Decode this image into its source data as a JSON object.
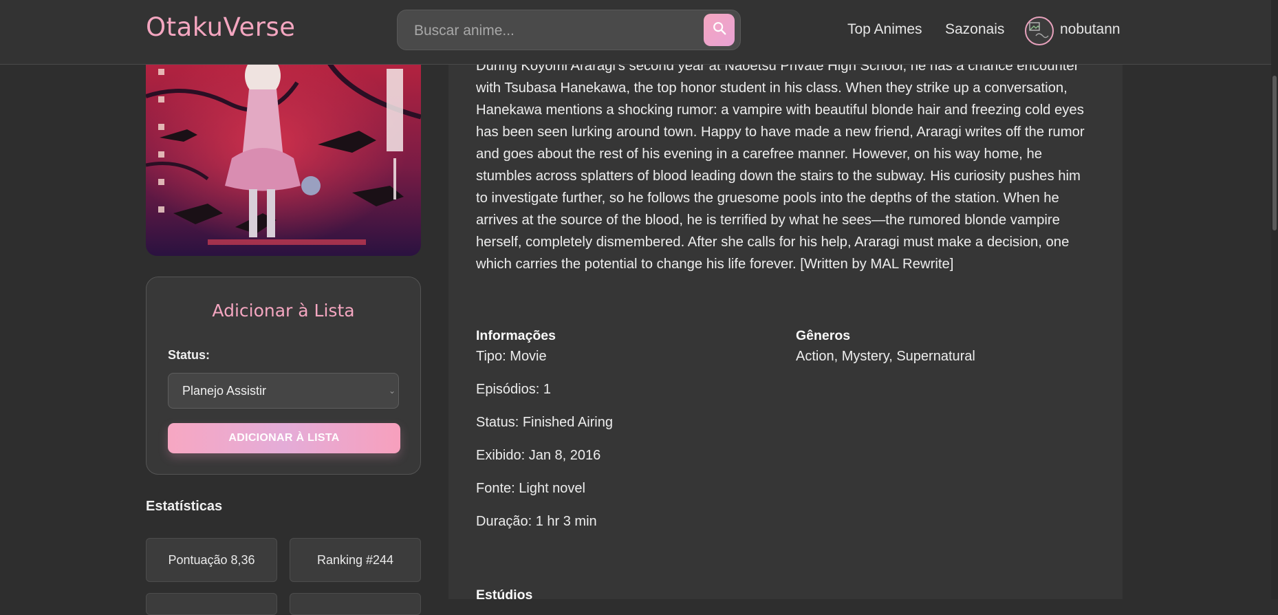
{
  "header": {
    "logo": "OtakuVerse",
    "search": {
      "placeholder": "Buscar anime...",
      "value": ""
    },
    "nav": [
      "Top Animes",
      "Sazonais"
    ],
    "username": "nobutann"
  },
  "poster": {
    "icon": "anime-poster-image",
    "colors": {
      "primary": "#c42a48",
      "secondary": "#2a1240"
    }
  },
  "add_to_list": {
    "title": "Adicionar à Lista",
    "status_label": "Status:",
    "selected_status": "Planejo Assistir",
    "button_label": "ADICIONAR À LISTA"
  },
  "stats": {
    "title": "Estatísticas",
    "items": [
      "Pontuação 8,36",
      "Ranking #244"
    ]
  },
  "synopsis": "During Koyomi Araragi's second year at Naoetsu Private High School, he has a chance encounter with Tsubasa Hanekawa, the top honor student in his class. When they strike up a conversation, Hanekawa mentions a shocking rumor: a vampire with beautiful blonde hair and freezing cold eyes has been seen lurking around town. Happy to have made a new friend, Araragi writes off the rumor and goes about the rest of his evening in a carefree manner. However, on his way home, he stumbles across splatters of blood leading down the stairs to the subway. His curiosity pushes him to investigate further, so he follows the gruesome pools into the depths of the station. When he arrives at the source of the blood, he is terrified by what he sees—the rumored blonde vampire herself, completely dismembered. After she calls for his help, Araragi must make a decision, one which carries the potential to change his life forever. [Written by MAL Rewrite]",
  "info": {
    "heading": "Informações",
    "lines": [
      "Tipo: Movie",
      "Episódios: 1",
      "Status: Finished Airing",
      "Exibido: Jan 8, 2016",
      "Fonte: Light novel",
      "Duração: 1 hr 3 min"
    ]
  },
  "genres": {
    "heading": "Gêneros",
    "list": "Action, Mystery, Supernatural"
  },
  "studios": {
    "heading": "Estúdios"
  },
  "theme": {
    "accent": "#f4a6c0",
    "background": "#2e2e2e",
    "panel": "#363636"
  }
}
